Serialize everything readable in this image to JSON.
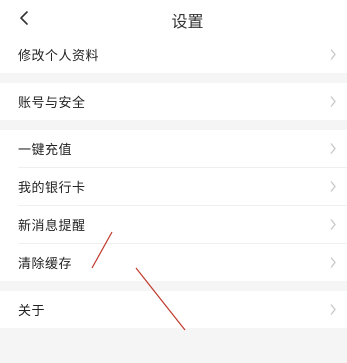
{
  "header": {
    "back_icon": "chevron-left-icon",
    "title": "设置"
  },
  "settings": {
    "items": [
      {
        "label": "修改个人资料",
        "icon": "chevron-right-icon"
      },
      {
        "label": "账号与安全",
        "icon": "chevron-right-icon"
      },
      {
        "label": "一键充值",
        "icon": "chevron-right-icon"
      },
      {
        "label": "我的银行卡",
        "icon": "chevron-right-icon"
      },
      {
        "label": "新消息提醒",
        "icon": "chevron-right-icon"
      },
      {
        "label": "清除缓存",
        "icon": "chevron-right-icon"
      },
      {
        "label": "关于",
        "icon": "chevron-right-icon"
      }
    ]
  },
  "colors": {
    "background": "#f5f5f5",
    "row_background": "#ffffff",
    "text": "#222222",
    "chevron": "#c8c8c8",
    "annotation_line": "#c0392b"
  }
}
